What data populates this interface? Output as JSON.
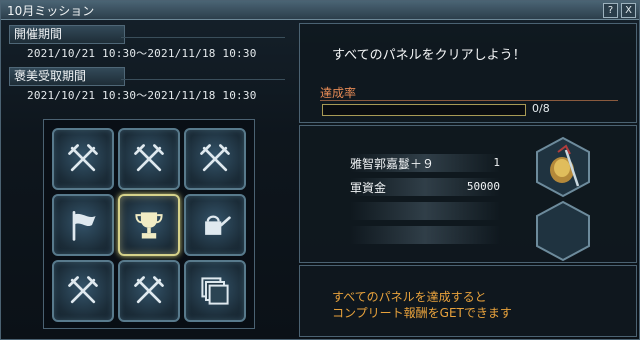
{
  "window": {
    "title": "10月ミッション",
    "help_label": "?",
    "close_label": "X"
  },
  "period": {
    "event_label": "開催期間",
    "event_dates": "2021/10/21 10:30～2021/11/18 10:30",
    "reward_label": "褒美受取期間",
    "reward_dates": "2021/10/21 10:30～2021/11/18 10:30"
  },
  "panels": [
    {
      "icon": "crossed-swords-icon"
    },
    {
      "icon": "crossed-swords-icon"
    },
    {
      "icon": "crossed-swords-icon"
    },
    {
      "icon": "flag-icon"
    },
    {
      "icon": "trophy-icon",
      "selected": true
    },
    {
      "icon": "watering-can-icon"
    },
    {
      "icon": "crossed-swords-icon"
    },
    {
      "icon": "crossed-swords-icon"
    },
    {
      "icon": "stacked-cards-icon"
    }
  ],
  "mission": {
    "heading": "すべてのパネルをクリアしよう！",
    "rate_label": "達成率",
    "rate_text": "0/8",
    "progress": 0
  },
  "rewards": [
    {
      "name": "雅智郭嘉鬘＋９",
      "qty": "1"
    },
    {
      "name": "軍資金",
      "qty": "50000"
    }
  ],
  "complete_note": {
    "line1": "すべてのパネルを達成すると",
    "line2": "コンプリート報酬をGETできます"
  },
  "colors": {
    "accent": "#e8a23c",
    "rate_label": "#e58a55",
    "panel_border": "#587a8c",
    "selected_border": "#d6d28a"
  }
}
